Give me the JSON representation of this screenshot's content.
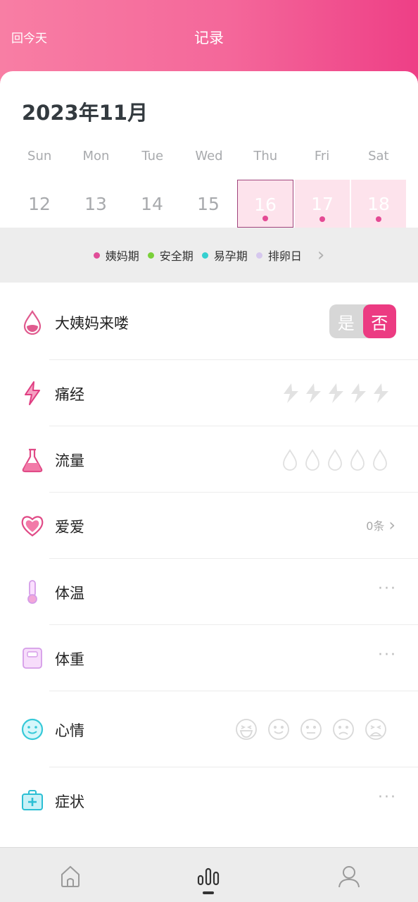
{
  "header": {
    "back_today": "回今天",
    "title": "记录"
  },
  "calendar": {
    "month": "2023年11月",
    "weekdays": [
      "Sun",
      "Mon",
      "Tue",
      "Wed",
      "Thu",
      "Fri",
      "Sat"
    ],
    "dates": [
      "12",
      "13",
      "14",
      "15",
      "16",
      "17",
      "18"
    ]
  },
  "legend": [
    {
      "label": "姨妈期",
      "color": "#e04d98"
    },
    {
      "label": "安全期",
      "color": "#7ad03a"
    },
    {
      "label": "易孕期",
      "color": "#35d0d0"
    },
    {
      "label": "排卵日",
      "color": "#d6c8ee"
    }
  ],
  "rows": {
    "period": {
      "label": "大姨妈来喽",
      "yes": "是",
      "no": "否"
    },
    "cramps": {
      "label": "痛经"
    },
    "flow": {
      "label": "流量"
    },
    "love": {
      "label": "爱爱",
      "count": "0条"
    },
    "temperature": {
      "label": "体温",
      "more": "···"
    },
    "weight": {
      "label": "体重",
      "more": "···"
    },
    "mood": {
      "label": "心情"
    },
    "symptoms": {
      "label": "症状",
      "more": "···"
    }
  },
  "tabbar": {
    "home": "home-icon",
    "record": "record-icon",
    "profile": "user-icon"
  }
}
